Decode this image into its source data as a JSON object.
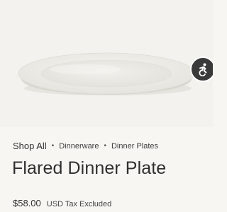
{
  "product": {
    "image_alt": "Flared Dinner Plate",
    "title": "Flared Dinner Plate",
    "price": "$58.00",
    "tax_note": "USD Tax Excluded"
  },
  "breadcrumb": {
    "items": [
      "Shop All",
      "Dinnerware",
      "Dinner Plates"
    ],
    "separator": "•"
  },
  "accessibility_button": {
    "icon": "accessibility-person-icon",
    "label": "Accessibility"
  },
  "colors": {
    "background": "#f7f6f2",
    "plate": "#eeede8",
    "text": "#2f2f2f",
    "a11y_button": "#3a3a3a"
  }
}
